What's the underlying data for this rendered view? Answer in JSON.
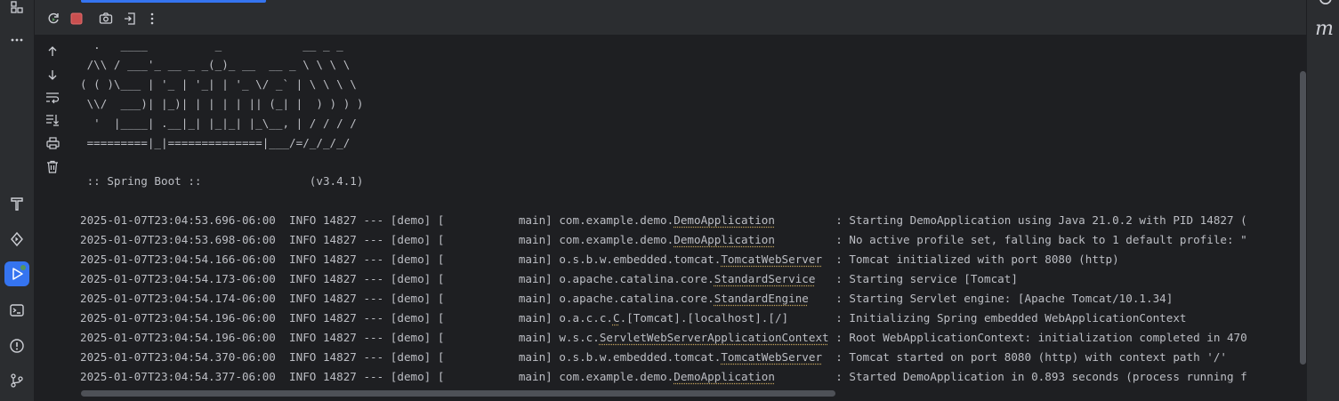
{
  "left_toolbar": {
    "items": [
      {
        "icon": "structure-icon",
        "active": false
      },
      {
        "icon": "more-icon",
        "active": false
      },
      {
        "icon": "build-icon",
        "active": false
      },
      {
        "icon": "services-icon",
        "active": false
      },
      {
        "icon": "run-icon",
        "active": true
      },
      {
        "icon": "terminal-icon",
        "active": false
      },
      {
        "icon": "problems-icon",
        "active": false
      },
      {
        "icon": "git-icon",
        "active": false
      }
    ]
  },
  "right_toolbar": {
    "glyph": "m"
  },
  "run_toolbar": {
    "buttons": [
      {
        "name": "rerun-icon"
      },
      {
        "name": "stop-icon"
      },
      {
        "name": "camera-icon"
      },
      {
        "name": "exit-icon"
      },
      {
        "name": "more-vert-icon"
      }
    ]
  },
  "console_tools": [
    "up-arrow-icon",
    "down-arrow-icon",
    "soft-wrap-icon",
    "scroll-to-end-icon",
    "print-icon",
    "trash-icon"
  ],
  "banner": [
    "  .   ____          _            __ _ _",
    " /\\\\ / ___'_ __ _ _(_)_ __  __ _ \\ \\ \\ \\",
    "( ( )\\___ | '_ | '_| | '_ \\/ _` | \\ \\ \\ \\",
    " \\\\/  ___)| |_)| | | | | || (_| |  ) ) ) )",
    "  '  |____| .__|_| |_|_| |_\\__, | / / / /",
    " =========|_|==============|___/=/_/_/_/",
    "",
    " :: Spring Boot ::                (v3.4.1)"
  ],
  "logs": [
    {
      "prefix": "2025-01-07T23:04:53.696-06:00  INFO 14827 --- [demo] [           main] com.example.demo.",
      "cls": "DemoApplication",
      "pad": "         ",
      "msg": ": Starting DemoApplication using Java 21.0.2 with PID 14827 ("
    },
    {
      "prefix": "2025-01-07T23:04:53.698-06:00  INFO 14827 --- [demo] [           main] com.example.demo.",
      "cls": "DemoApplication",
      "pad": "         ",
      "msg": ": No active profile set, falling back to 1 default profile: \""
    },
    {
      "prefix": "2025-01-07T23:04:54.166-06:00  INFO 14827 --- [demo] [           main] o.s.b.w.embedded.tomcat.",
      "cls": "TomcatWebServer",
      "pad": "  ",
      "msg": ": Tomcat initialized with port 8080 (http)"
    },
    {
      "prefix": "2025-01-07T23:04:54.173-06:00  INFO 14827 --- [demo] [           main] o.apache.catalina.core.",
      "cls": "StandardService",
      "pad": "   ",
      "msg": ": Starting service [Tomcat]"
    },
    {
      "prefix": "2025-01-07T23:04:54.174-06:00  INFO 14827 --- [demo] [           main] o.apache.catalina.core.",
      "cls": "StandardEngine",
      "pad": "    ",
      "msg": ": Starting Servlet engine: [Apache Tomcat/10.1.34]"
    },
    {
      "prefix": "2025-01-07T23:04:54.196-06:00  INFO 14827 --- [demo] [           main] o.a.c.c.",
      "cls": "C",
      "pad": ".[Tomcat].[localhost].[/]       ",
      "msg": ": Initializing Spring embedded WebApplicationContext"
    },
    {
      "prefix": "2025-01-07T23:04:54.196-06:00  INFO 14827 --- [demo] [           main] w.s.c.",
      "cls": "ServletWebServerApplicationContext",
      "pad": " ",
      "msg": ": Root WebApplicationContext: initialization completed in 470"
    },
    {
      "prefix": "2025-01-07T23:04:54.370-06:00  INFO 14827 --- [demo] [           main] o.s.b.w.embedded.tomcat.",
      "cls": "TomcatWebServer",
      "pad": "  ",
      "msg": ": Tomcat started on port 8080 (http) with context path '/'"
    },
    {
      "prefix": "2025-01-07T23:04:54.377-06:00  INFO 14827 --- [demo] [           main] com.example.demo.",
      "cls": "DemoApplication",
      "pad": "         ",
      "msg": ": Started DemoApplication in 0.893 seconds (process running f"
    }
  ]
}
